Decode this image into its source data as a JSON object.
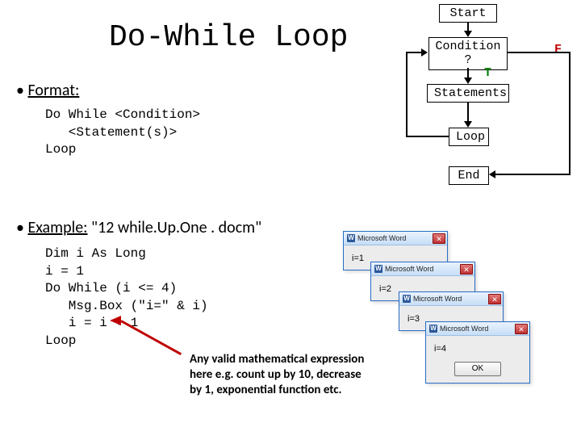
{
  "title": "Do-While Loop",
  "format": {
    "heading": "Format:",
    "code": "Do While <Condition>\n   <Statement(s)>\nLoop"
  },
  "example": {
    "heading": "Example:",
    "filename": "\"12 while.Up.One . docm\"",
    "code": "Dim i As Long\ni = 1\nDo While (i <= 4)\n   Msg.Box (\"i=\" & i)\n   i = i + 1\nLoop"
  },
  "annotation": "Any valid mathematical expression here e.g. count up by 10, decrease by 1, exponential function etc.",
  "flow": {
    "start": "Start",
    "condition": "Condition\n?",
    "t": "T",
    "f": "F",
    "statements": "Statements",
    "loop": "Loop",
    "end": "End"
  },
  "dialogs": {
    "app": "Microsoft Word",
    "ok": "OK",
    "msgs": [
      "i=1",
      "i=2",
      "i=3",
      "i=4"
    ]
  }
}
